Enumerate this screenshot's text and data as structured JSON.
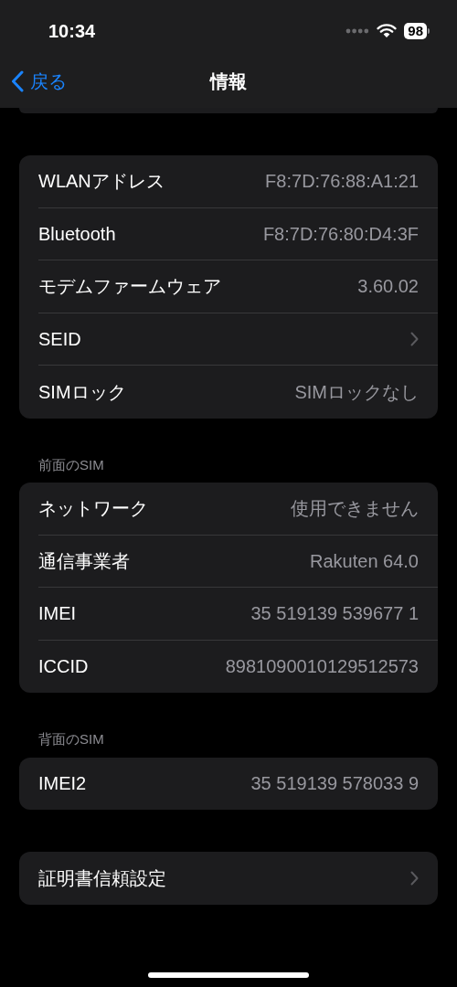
{
  "status_bar": {
    "time": "10:34",
    "battery": "98"
  },
  "nav": {
    "back": "戻る",
    "title": "情報"
  },
  "groups": [
    {
      "rows": [
        {
          "kind": "value",
          "label": "WLANアドレス",
          "value": "F8:7D:76:88:A1:21"
        },
        {
          "kind": "value",
          "label": "Bluetooth",
          "value": "F8:7D:76:80:D4:3F"
        },
        {
          "kind": "value",
          "label": "モデムファームウェア",
          "value": "3.60.02"
        },
        {
          "kind": "disclosure",
          "label": "SEID"
        },
        {
          "kind": "value",
          "label": "SIMロック",
          "value": "SIMロックなし"
        }
      ]
    },
    {
      "header": "前面のSIM",
      "rows": [
        {
          "kind": "value",
          "label": "ネットワーク",
          "value": "使用できません"
        },
        {
          "kind": "value",
          "label": "通信事業者",
          "value": "Rakuten 64.0"
        },
        {
          "kind": "value",
          "label": "IMEI",
          "value": "35 519139 539677 1"
        },
        {
          "kind": "value",
          "label": "ICCID",
          "value": "8981090010129512573"
        }
      ]
    },
    {
      "header": "背面のSIM",
      "rows": [
        {
          "kind": "value",
          "label": "IMEI2",
          "value": "35 519139 578033 9"
        }
      ]
    },
    {
      "rows": [
        {
          "kind": "disclosure",
          "label": "証明書信頼設定"
        }
      ]
    }
  ]
}
